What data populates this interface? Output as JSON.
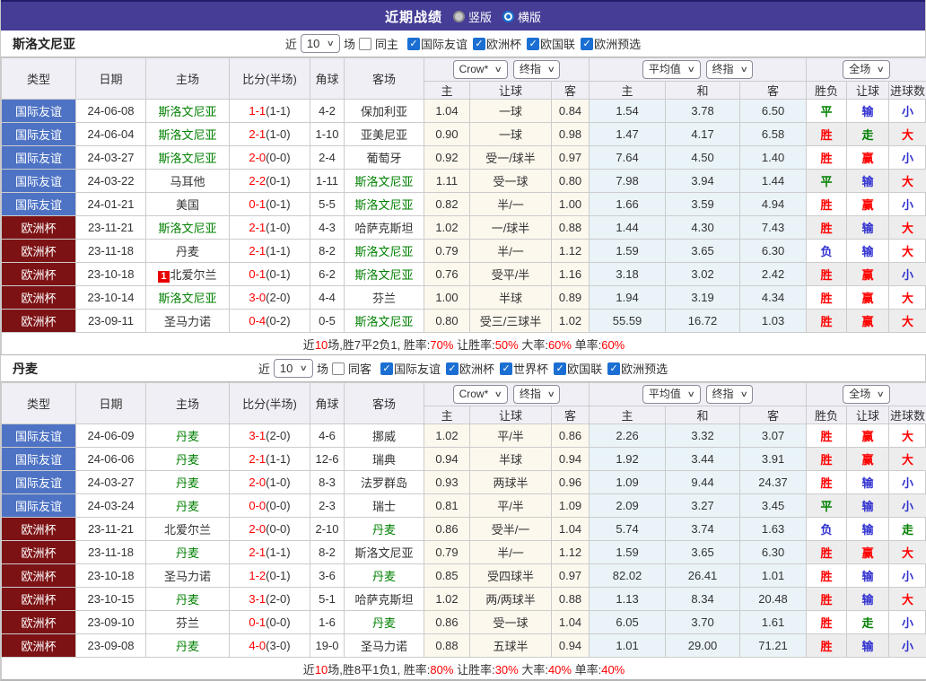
{
  "header": {
    "title": "近期战绩",
    "layout_options": [
      {
        "label": "竖版",
        "selected": false
      },
      {
        "label": "横版",
        "selected": true
      }
    ]
  },
  "labels": {
    "recent": "近",
    "games": "场"
  },
  "table": {
    "columns": {
      "type": "类型",
      "date": "日期",
      "home": "主场",
      "score": "比分(半场)",
      "corner": "角球",
      "away": "客场"
    },
    "sub_columns": [
      "主",
      "让球",
      "客",
      "主",
      "和",
      "客",
      "胜负",
      "让球",
      "进球数"
    ],
    "dropdowns": {
      "bookmaker": "Crow*",
      "bookmaker_stage": "终指",
      "average": "平均值",
      "average_stage": "终指",
      "scope": "全场"
    }
  },
  "colors": {
    "accent_bar": "#453d96",
    "team_highlight": "#008000",
    "score": "#ff0000",
    "type": {
      "国际友谊": "#4e73c4",
      "欧洲杯": "#7c1214"
    },
    "result": {
      "胜": "#ff0000",
      "平": "#008000",
      "负": "#3030d0",
      "赢": "#ff0000",
      "走": "#008000",
      "输": "#3030d0",
      "大": "#ff0000",
      "小": "#3030d0"
    }
  },
  "sections": [
    {
      "team": "斯洛文尼亚",
      "filter": {
        "count": "10",
        "same_label": "同主",
        "same_checked": false,
        "competitions": [
          {
            "label": "国际友谊",
            "checked": true
          },
          {
            "label": "欧洲杯",
            "checked": true
          },
          {
            "label": "欧国联",
            "checked": true
          },
          {
            "label": "欧洲预选",
            "checked": true
          }
        ]
      },
      "rows": [
        {
          "type": "国际友谊",
          "date": "24-06-08",
          "home": "斯洛文尼亚",
          "home_focus": true,
          "score": "1-1",
          "half": "(1-1)",
          "corners": "4-2",
          "away": "保加利亚",
          "away_focus": false,
          "odds_home": "1.04",
          "handicap": "一球",
          "odds_away": "0.84",
          "avg_home": "1.54",
          "avg_draw": "3.78",
          "avg_away": "6.50",
          "result_wdl": "平",
          "result_handicap": "输",
          "result_goals": "小"
        },
        {
          "type": "国际友谊",
          "date": "24-06-04",
          "home": "斯洛文尼亚",
          "home_focus": true,
          "score": "2-1",
          "half": "(1-0)",
          "corners": "1-10",
          "away": "亚美尼亚",
          "away_focus": false,
          "odds_home": "0.90",
          "handicap": "一球",
          "odds_away": "0.98",
          "avg_home": "1.47",
          "avg_draw": "4.17",
          "avg_away": "6.58",
          "result_wdl": "胜",
          "result_handicap": "走",
          "result_goals": "大"
        },
        {
          "type": "国际友谊",
          "date": "24-03-27",
          "home": "斯洛文尼亚",
          "home_focus": true,
          "score": "2-0",
          "half": "(0-0)",
          "corners": "2-4",
          "away": "葡萄牙",
          "away_focus": false,
          "odds_home": "0.92",
          "handicap": "受一/球半",
          "odds_away": "0.97",
          "avg_home": "7.64",
          "avg_draw": "4.50",
          "avg_away": "1.40",
          "result_wdl": "胜",
          "result_handicap": "赢",
          "result_goals": "小"
        },
        {
          "type": "国际友谊",
          "date": "24-03-22",
          "home": "马耳他",
          "home_focus": false,
          "score": "2-2",
          "half": "(0-1)",
          "corners": "1-11",
          "away": "斯洛文尼亚",
          "away_focus": true,
          "odds_home": "1.11",
          "handicap": "受一球",
          "odds_away": "0.80",
          "avg_home": "7.98",
          "avg_draw": "3.94",
          "avg_away": "1.44",
          "result_wdl": "平",
          "result_handicap": "输",
          "result_goals": "大"
        },
        {
          "type": "国际友谊",
          "date": "24-01-21",
          "home": "美国",
          "home_focus": false,
          "score": "0-1",
          "half": "(0-1)",
          "corners": "5-5",
          "away": "斯洛文尼亚",
          "away_focus": true,
          "odds_home": "0.82",
          "handicap": "半/一",
          "odds_away": "1.00",
          "avg_home": "1.66",
          "avg_draw": "3.59",
          "avg_away": "4.94",
          "result_wdl": "胜",
          "result_handicap": "赢",
          "result_goals": "小"
        },
        {
          "type": "欧洲杯",
          "date": "23-11-21",
          "home": "斯洛文尼亚",
          "home_focus": true,
          "score": "2-1",
          "half": "(1-0)",
          "corners": "4-3",
          "away": "哈萨克斯坦",
          "away_focus": false,
          "odds_home": "1.02",
          "handicap": "一/球半",
          "odds_away": "0.88",
          "avg_home": "1.44",
          "avg_draw": "4.30",
          "avg_away": "7.43",
          "result_wdl": "胜",
          "result_handicap": "输",
          "result_goals": "大"
        },
        {
          "type": "欧洲杯",
          "date": "23-11-18",
          "home": "丹麦",
          "home_focus": false,
          "score": "2-1",
          "half": "(1-1)",
          "corners": "8-2",
          "away": "斯洛文尼亚",
          "away_focus": true,
          "odds_home": "0.79",
          "handicap": "半/一",
          "odds_away": "1.12",
          "avg_home": "1.59",
          "avg_draw": "3.65",
          "avg_away": "6.30",
          "result_wdl": "负",
          "result_handicap": "输",
          "result_goals": "大"
        },
        {
          "type": "欧洲杯",
          "date": "23-10-18",
          "home": "北爱尔兰",
          "home_focus": false,
          "home_red_card": "1",
          "score": "0-1",
          "half": "(0-1)",
          "corners": "6-2",
          "away": "斯洛文尼亚",
          "away_focus": true,
          "odds_home": "0.76",
          "handicap": "受平/半",
          "odds_away": "1.16",
          "avg_home": "3.18",
          "avg_draw": "3.02",
          "avg_away": "2.42",
          "result_wdl": "胜",
          "result_handicap": "赢",
          "result_goals": "小"
        },
        {
          "type": "欧洲杯",
          "date": "23-10-14",
          "home": "斯洛文尼亚",
          "home_focus": true,
          "score": "3-0",
          "half": "(2-0)",
          "corners": "4-4",
          "away": "芬兰",
          "away_focus": false,
          "odds_home": "1.00",
          "handicap": "半球",
          "odds_away": "0.89",
          "avg_home": "1.94",
          "avg_draw": "3.19",
          "avg_away": "4.34",
          "result_wdl": "胜",
          "result_handicap": "赢",
          "result_goals": "大"
        },
        {
          "type": "欧洲杯",
          "date": "23-09-11",
          "home": "圣马力诺",
          "home_focus": false,
          "score": "0-4",
          "half": "(0-2)",
          "corners": "0-5",
          "away": "斯洛文尼亚",
          "away_focus": true,
          "odds_home": "0.80",
          "handicap": "受三/三球半",
          "odds_away": "1.02",
          "avg_home": "55.59",
          "avg_draw": "16.72",
          "avg_away": "1.03",
          "result_wdl": "胜",
          "result_handicap": "赢",
          "result_goals": "大"
        }
      ],
      "summary": [
        {
          "text": "近",
          "color": "k"
        },
        {
          "text": "10",
          "color": "r"
        },
        {
          "text": "场,胜7平2负1, 胜率:",
          "color": "k"
        },
        {
          "text": "70%",
          "color": "r"
        },
        {
          "text": " 让胜率:",
          "color": "k"
        },
        {
          "text": "50%",
          "color": "r"
        },
        {
          "text": " 大率:",
          "color": "k"
        },
        {
          "text": "60%",
          "color": "r"
        },
        {
          "text": " 单率:",
          "color": "k"
        },
        {
          "text": "60%",
          "color": "r"
        }
      ]
    },
    {
      "team": "丹麦",
      "filter": {
        "count": "10",
        "same_label": "同客",
        "same_checked": false,
        "competitions": [
          {
            "label": "国际友谊",
            "checked": true
          },
          {
            "label": "欧洲杯",
            "checked": true
          },
          {
            "label": "世界杯",
            "checked": true
          },
          {
            "label": "欧国联",
            "checked": true
          },
          {
            "label": "欧洲预选",
            "checked": true
          }
        ]
      },
      "rows": [
        {
          "type": "国际友谊",
          "date": "24-06-09",
          "home": "丹麦",
          "home_focus": true,
          "score": "3-1",
          "half": "(2-0)",
          "corners": "4-6",
          "away": "挪威",
          "away_focus": false,
          "odds_home": "1.02",
          "handicap": "平/半",
          "odds_away": "0.86",
          "avg_home": "2.26",
          "avg_draw": "3.32",
          "avg_away": "3.07",
          "result_wdl": "胜",
          "result_handicap": "赢",
          "result_goals": "大"
        },
        {
          "type": "国际友谊",
          "date": "24-06-06",
          "home": "丹麦",
          "home_focus": true,
          "score": "2-1",
          "half": "(1-1)",
          "corners": "12-6",
          "away": "瑞典",
          "away_focus": false,
          "odds_home": "0.94",
          "handicap": "半球",
          "odds_away": "0.94",
          "avg_home": "1.92",
          "avg_draw": "3.44",
          "avg_away": "3.91",
          "result_wdl": "胜",
          "result_handicap": "赢",
          "result_goals": "大"
        },
        {
          "type": "国际友谊",
          "date": "24-03-27",
          "home": "丹麦",
          "home_focus": true,
          "score": "2-0",
          "half": "(1-0)",
          "corners": "8-3",
          "away": "法罗群岛",
          "away_focus": false,
          "odds_home": "0.93",
          "handicap": "两球半",
          "odds_away": "0.96",
          "avg_home": "1.09",
          "avg_draw": "9.44",
          "avg_away": "24.37",
          "result_wdl": "胜",
          "result_handicap": "输",
          "result_goals": "小"
        },
        {
          "type": "国际友谊",
          "date": "24-03-24",
          "home": "丹麦",
          "home_focus": true,
          "score": "0-0",
          "half": "(0-0)",
          "corners": "2-3",
          "away": "瑞士",
          "away_focus": false,
          "odds_home": "0.81",
          "handicap": "平/半",
          "odds_away": "1.09",
          "avg_home": "2.09",
          "avg_draw": "3.27",
          "avg_away": "3.45",
          "result_wdl": "平",
          "result_handicap": "输",
          "result_goals": "小"
        },
        {
          "type": "欧洲杯",
          "date": "23-11-21",
          "home": "北爱尔兰",
          "home_focus": false,
          "score": "2-0",
          "half": "(0-0)",
          "corners": "2-10",
          "away": "丹麦",
          "away_focus": true,
          "odds_home": "0.86",
          "handicap": "受半/一",
          "odds_away": "1.04",
          "avg_home": "5.74",
          "avg_draw": "3.74",
          "avg_away": "1.63",
          "result_wdl": "负",
          "result_handicap": "输",
          "result_goals": "走"
        },
        {
          "type": "欧洲杯",
          "date": "23-11-18",
          "home": "丹麦",
          "home_focus": true,
          "score": "2-1",
          "half": "(1-1)",
          "corners": "8-2",
          "away": "斯洛文尼亚",
          "away_focus": false,
          "odds_home": "0.79",
          "handicap": "半/一",
          "odds_away": "1.12",
          "avg_home": "1.59",
          "avg_draw": "3.65",
          "avg_away": "6.30",
          "result_wdl": "胜",
          "result_handicap": "赢",
          "result_goals": "大"
        },
        {
          "type": "欧洲杯",
          "date": "23-10-18",
          "home": "圣马力诺",
          "home_focus": false,
          "score": "1-2",
          "half": "(0-1)",
          "corners": "3-6",
          "away": "丹麦",
          "away_focus": true,
          "odds_home": "0.85",
          "handicap": "受四球半",
          "odds_away": "0.97",
          "avg_home": "82.02",
          "avg_draw": "26.41",
          "avg_away": "1.01",
          "result_wdl": "胜",
          "result_handicap": "输",
          "result_goals": "小"
        },
        {
          "type": "欧洲杯",
          "date": "23-10-15",
          "home": "丹麦",
          "home_focus": true,
          "score": "3-1",
          "half": "(2-0)",
          "corners": "5-1",
          "away": "哈萨克斯坦",
          "away_focus": false,
          "odds_home": "1.02",
          "handicap": "两/两球半",
          "odds_away": "0.88",
          "avg_home": "1.13",
          "avg_draw": "8.34",
          "avg_away": "20.48",
          "result_wdl": "胜",
          "result_handicap": "输",
          "result_goals": "大"
        },
        {
          "type": "欧洲杯",
          "date": "23-09-10",
          "home": "芬兰",
          "home_focus": false,
          "score": "0-1",
          "half": "(0-0)",
          "corners": "1-6",
          "away": "丹麦",
          "away_focus": true,
          "odds_home": "0.86",
          "handicap": "受一球",
          "odds_away": "1.04",
          "avg_home": "6.05",
          "avg_draw": "3.70",
          "avg_away": "1.61",
          "result_wdl": "胜",
          "result_handicap": "走",
          "result_goals": "小"
        },
        {
          "type": "欧洲杯",
          "date": "23-09-08",
          "home": "丹麦",
          "home_focus": true,
          "score": "4-0",
          "half": "(3-0)",
          "corners": "19-0",
          "away": "圣马力诺",
          "away_focus": false,
          "odds_home": "0.88",
          "handicap": "五球半",
          "odds_away": "0.94",
          "avg_home": "1.01",
          "avg_draw": "29.00",
          "avg_away": "71.21",
          "result_wdl": "胜",
          "result_handicap": "输",
          "result_goals": "小"
        }
      ],
      "summary": [
        {
          "text": "近",
          "color": "k"
        },
        {
          "text": "10",
          "color": "r"
        },
        {
          "text": "场,胜8平1负1, 胜率:",
          "color": "k"
        },
        {
          "text": "80%",
          "color": "r"
        },
        {
          "text": " 让胜率:",
          "color": "k"
        },
        {
          "text": "30%",
          "color": "r"
        },
        {
          "text": " 大率:",
          "color": "k"
        },
        {
          "text": "40%",
          "color": "r"
        },
        {
          "text": " 单率:",
          "color": "k"
        },
        {
          "text": "40%",
          "color": "r"
        }
      ]
    }
  ]
}
